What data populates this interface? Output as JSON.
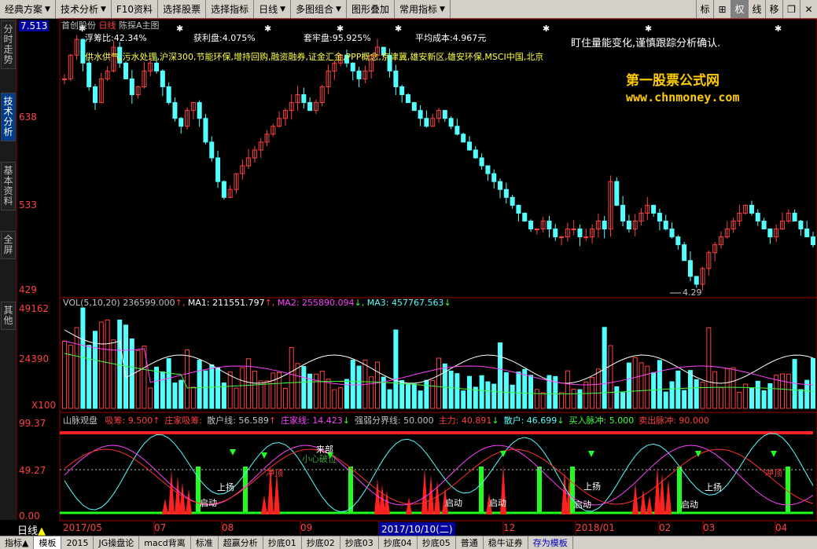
{
  "toolbar": {
    "left": [
      {
        "label": "经典方案",
        "dropdown": true
      },
      {
        "label": "技术分析",
        "dropdown": true
      },
      {
        "label": "F10资料",
        "dropdown": false
      },
      {
        "label": "选择股票",
        "dropdown": false
      },
      {
        "label": "选择指标",
        "dropdown": false
      },
      {
        "label": "日线",
        "dropdown": true
      },
      {
        "label": "多图组合",
        "dropdown": true
      },
      {
        "label": "图形叠加",
        "dropdown": false
      },
      {
        "label": "常用指标",
        "dropdown": true
      }
    ],
    "right": [
      "标",
      "⊞",
      "权",
      "线",
      "移",
      "❐",
      "✕"
    ]
  },
  "left_tabs": [
    "分时走势",
    "技术分析",
    "基本资料",
    "全屏",
    "其他"
  ],
  "bottom_tabs": [
    "指标▲",
    "模板",
    "2015",
    "JG操盘论",
    "macd背离",
    "标准",
    "超赢分析",
    "抄底01",
    "抄底02",
    "抄底03",
    "抄底04",
    "抄底05",
    "普通",
    "稳牛证券",
    "存为模板"
  ],
  "price_panel": {
    "stock": "首创股份",
    "period": "日线",
    "indicator": "陈探A主图",
    "current_price": "7.513",
    "y_labels": [
      "638",
      "533",
      "429"
    ],
    "low_marker": "4.29",
    "stats": {
      "float_ratio": "浮筹比:42.34%",
      "profit": "获利盘:4.075%",
      "trapped": "套牢盘:95.925%",
      "avg_cost": "平均成本:4.967元"
    },
    "note": "盯住量能变化,谨慎跟踪分析确认.",
    "concepts": "供水供气,污水处理,沪深300,节能环保,增持回购,融资融券,证金汇金,PPP概念,京津冀,雄安新区,雄安环保,MSCI中国,北京",
    "watermark_title": "第一股票公式网",
    "watermark_url": "www.chnmoney.com",
    "colors": {
      "up": "#ff4040",
      "down": "#54ffff"
    }
  },
  "volume_panel": {
    "legend_name": "VOL(5,10,20)",
    "vol": "236599.000",
    "ma1": "MA1: 211551.797",
    "ma2": "MA2: 255890.094",
    "ma3": "MA3: 457767.563",
    "y_labels": [
      "49162",
      "24390",
      "X100"
    ]
  },
  "osc_panel": {
    "name": "山脉观盘",
    "fields": [
      {
        "label": "吸筹: 9.500",
        "arrow": "↑",
        "color": "#ff4040"
      },
      {
        "label": "庄家吸筹:",
        "arrow": "",
        "color": "#ff4040"
      },
      {
        "label": "散户线: 56.589",
        "arrow": "↑",
        "color": "#c0c0c0"
      },
      {
        "label": "庄家线: 14.423",
        "arrow": "↓",
        "color": "#ff40ff"
      },
      {
        "label": "强弱分界线: 50.000",
        "arrow": "",
        "color": "#c0c0c0"
      },
      {
        "label": "主力: 40.891",
        "arrow": "↓",
        "color": "#ff4040"
      },
      {
        "label": "散户: 46.699",
        "arrow": "↓",
        "color": "#54ffff"
      },
      {
        "label": "买入脉冲: 5.000",
        "arrow": "",
        "color": "#40ff40"
      },
      {
        "label": "卖出脉冲: 90.000",
        "arrow": "",
        "color": "#ff4040"
      }
    ],
    "y_labels": [
      "99.37",
      "49.27",
      "0.00"
    ],
    "annotations": [
      "冲顶",
      "上扬",
      "启动",
      "启动",
      "启动",
      "启动",
      "上扬",
      "冲顶",
      "上扬",
      "启动",
      "来部",
      "小心破位"
    ]
  },
  "x_axis": {
    "labels": [
      "2017/05",
      "07",
      "08",
      "09",
      "2017/10/10(二)",
      "12",
      "2018/01",
      "02",
      "03",
      "04"
    ],
    "period_label": "日线"
  },
  "chart_data": {
    "type": "candlestick",
    "note_y_units": "price; chart shows scale labels 638, 533, 429 and current price 7.513",
    "series": [
      {
        "name": "price",
        "values": [
          6.9,
          7.2,
          7.4,
          7.1,
          6.8,
          6.6,
          6.9,
          7.0,
          7.3,
          7.1,
          6.9,
          6.7,
          6.8,
          7.0,
          7.1,
          7.0,
          6.8,
          6.6,
          6.4,
          6.3,
          6.5,
          6.6,
          6.4,
          6.1,
          5.9,
          5.6,
          5.4,
          5.5,
          5.7,
          5.8,
          5.9,
          6.0,
          6.1,
          6.2,
          6.3,
          6.4,
          6.5,
          6.6,
          6.7,
          6.6,
          6.5,
          6.6,
          6.8,
          7.0,
          7.1,
          7.2,
          7.1,
          7.0,
          6.9,
          7.0,
          7.2,
          7.3,
          7.2,
          7.0,
          6.8,
          6.7,
          6.6,
          6.5,
          6.4,
          6.3,
          6.4,
          6.5,
          6.4,
          6.3,
          6.2,
          6.1,
          6.0,
          5.9,
          5.8,
          5.7,
          5.6,
          5.5,
          5.4,
          5.3,
          5.2,
          5.1,
          5.0,
          5.0,
          5.1,
          5.0,
          4.9,
          4.9,
          5.0,
          5.0,
          4.9,
          4.9,
          5.0,
          5.1,
          5.0,
          5.6,
          5.3,
          5.1,
          5.0,
          5.1,
          5.2,
          5.3,
          5.2,
          5.1,
          5.0,
          4.9,
          4.8,
          4.6,
          4.4,
          4.3,
          4.5,
          4.7,
          4.8,
          4.9,
          5.0,
          5.1,
          5.2,
          5.3,
          5.2,
          5.1,
          5.0,
          4.9,
          5.0,
          5.1,
          5.2,
          5.1,
          5.0,
          4.9,
          4.8
        ]
      }
    ]
  }
}
